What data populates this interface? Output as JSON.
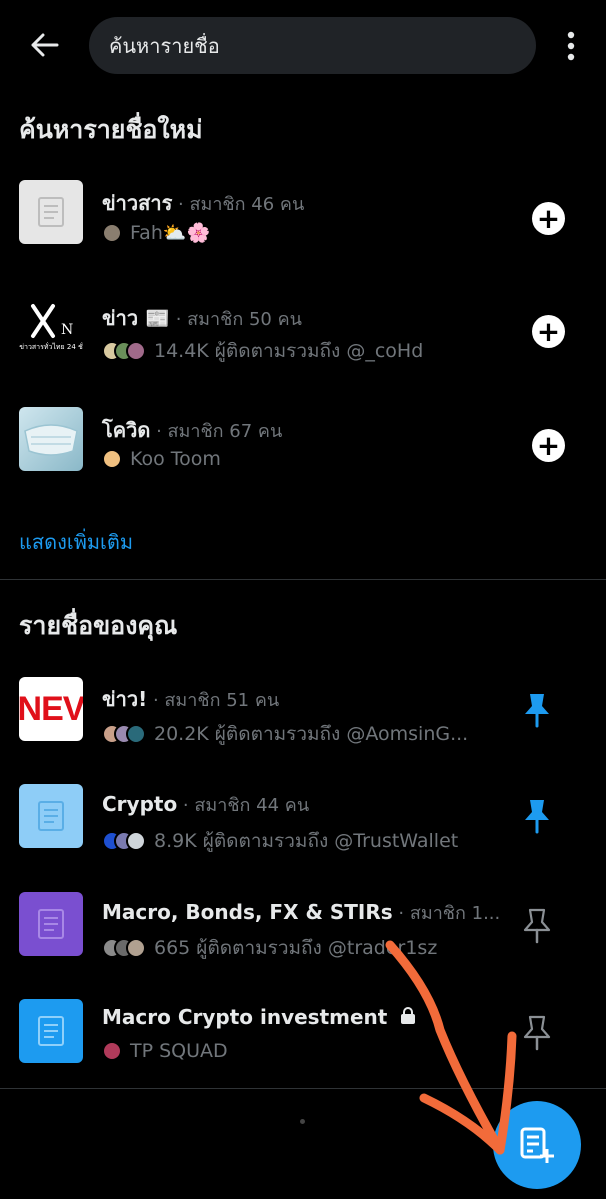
{
  "header": {
    "search_value": "ค้นหารายชื่อ"
  },
  "discover": {
    "title": "ค้นหารายชื่อใหม่",
    "items": [
      {
        "name": "ข่าวสาร",
        "meta": " · สมาชิก 46 คน",
        "sub": "Fah⛅🌸",
        "thumb_bg": "#e6e6e6"
      },
      {
        "name": "ข่าว 📰",
        "meta": " · สมาชิก 50 คน",
        "sub": "14.4K ผู้ติดตามรวมถึง @_coHd",
        "thumb_caption": "ข่าวสารทั่วไทย 24 ชั่"
      },
      {
        "name": "โควิด",
        "meta": " · สมาชิก 67 คน",
        "sub": "Koo Toom"
      }
    ],
    "show_more": "แสดงเพิ่มเติม"
  },
  "yours": {
    "title": "รายชื่อของคุณ",
    "items": [
      {
        "name": "ข่าว!",
        "meta": " · สมาชิก 51 คน",
        "sub": "20.2K ผู้ติดตามรวมถึง @AomsinG...",
        "pinned": true,
        "thumb_text": "NEV"
      },
      {
        "name": "Crypto",
        "meta": " · สมาชิก 44 คน",
        "sub": "8.9K ผู้ติดตามรวมถึง @TrustWallet",
        "pinned": true
      },
      {
        "name": "Macro, Bonds, FX & STIRs",
        "meta": " · สมาชิก 1...",
        "sub": "665 ผู้ติดตามรวมถึง @trader1sz",
        "pinned": false
      },
      {
        "name": "Macro Crypto investment",
        "sub": "TP SQUAD",
        "pinned": false,
        "private": true
      }
    ]
  },
  "colors": {
    "accent": "#1d9bf0",
    "annotation": "#f26b3a"
  }
}
